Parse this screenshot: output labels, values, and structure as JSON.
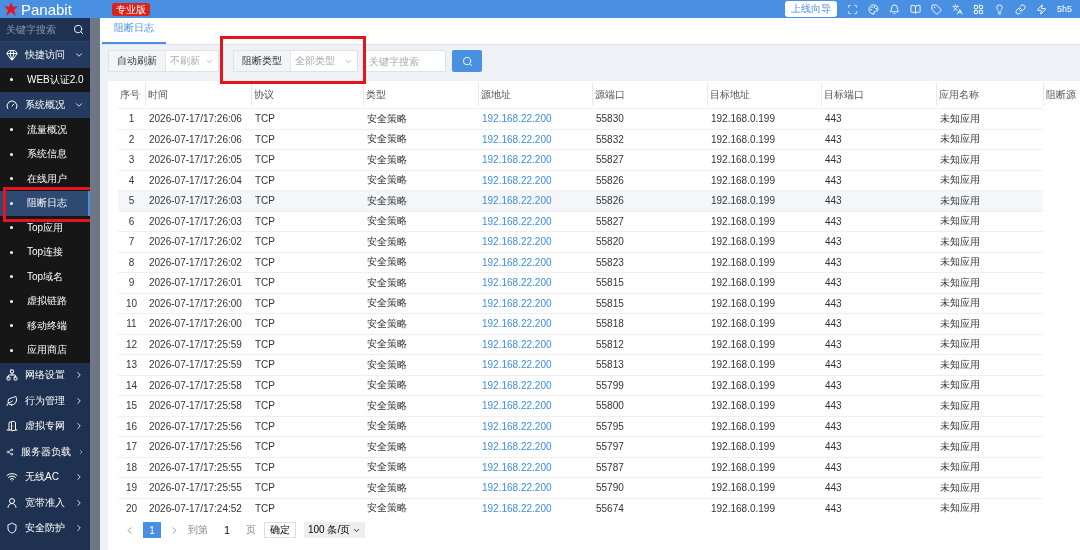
{
  "header": {
    "logo": "Panabit",
    "edition_badge": "专业版",
    "guide_button": "上线向导",
    "corner_text": "5h5"
  },
  "sidebar": {
    "search": {
      "placeholder": "关键字搜索"
    },
    "groups": [
      {
        "label": "快捷访问",
        "expanded": true,
        "children": [
          {
            "label": "WEB认证2.0",
            "selected": false,
            "highlighted": false
          }
        ]
      },
      {
        "label": "系统概况",
        "expanded": true,
        "children": [
          {
            "label": "流量概况",
            "selected": false,
            "highlighted": false
          },
          {
            "label": "系统信息",
            "selected": false,
            "highlighted": false
          },
          {
            "label": "在线用户",
            "selected": false,
            "highlighted": false
          },
          {
            "label": "阻断日志",
            "selected": true,
            "highlighted": true
          },
          {
            "label": "Top应用",
            "selected": false,
            "highlighted": false
          },
          {
            "label": "Top连接",
            "selected": false,
            "highlighted": false
          },
          {
            "label": "Top域名",
            "selected": false,
            "highlighted": false
          },
          {
            "label": "虚拟链路",
            "selected": false,
            "highlighted": false
          },
          {
            "label": "移动终端",
            "selected": false,
            "highlighted": false
          },
          {
            "label": "应用商店",
            "selected": false,
            "highlighted": false
          }
        ]
      },
      {
        "label": "网络设置",
        "expanded": false
      },
      {
        "label": "行为管理",
        "expanded": false
      },
      {
        "label": "虚拟专网",
        "expanded": false
      },
      {
        "label": "服务器负载",
        "expanded": false
      },
      {
        "label": "无线AC",
        "expanded": false
      },
      {
        "label": "宽带准入",
        "expanded": false
      },
      {
        "label": "安全防护",
        "expanded": false
      }
    ]
  },
  "tabs": [
    {
      "label": "阻断日志",
      "selected": true
    }
  ],
  "filters": [
    {
      "label": "自动刷新",
      "value": "不刷新"
    },
    {
      "label": "阻断类型",
      "value": "全部类型",
      "highlighted": true
    }
  ],
  "search": {
    "placeholder": "关键字搜索"
  },
  "table": {
    "columns": [
      "序号",
      "时间",
      "协议",
      "类型",
      "源地址",
      "源端口",
      "目标地址",
      "目标端口",
      "应用名称",
      "阻断源"
    ],
    "rows": [
      [
        "1",
        "2026-07-17/17:26:06",
        "TCP",
        "安全策略",
        "192.168.22.200",
        "55830",
        "192.168.0.199",
        "443",
        "未知应用"
      ],
      [
        "2",
        "2026-07-17/17:26:06",
        "TCP",
        "安全策略",
        "192.168.22.200",
        "55832",
        "192.168.0.199",
        "443",
        "未知应用"
      ],
      [
        "3",
        "2026-07-17/17:26:05",
        "TCP",
        "安全策略",
        "192.168.22.200",
        "55827",
        "192.168.0.199",
        "443",
        "未知应用"
      ],
      [
        "4",
        "2026-07-17/17:26:04",
        "TCP",
        "安全策略",
        "192.168.22.200",
        "55826",
        "192.168.0.199",
        "443",
        "未知应用"
      ],
      [
        "5",
        "2026-07-17/17:26:03",
        "TCP",
        "安全策略",
        "192.168.22.200",
        "55826",
        "192.168.0.199",
        "443",
        "未知应用"
      ],
      [
        "6",
        "2026-07-17/17:26:03",
        "TCP",
        "安全策略",
        "192.168.22.200",
        "55827",
        "192.168.0.199",
        "443",
        "未知应用"
      ],
      [
        "7",
        "2026-07-17/17:26:02",
        "TCP",
        "安全策略",
        "192.168.22.200",
        "55820",
        "192.168.0.199",
        "443",
        "未知应用"
      ],
      [
        "8",
        "2026-07-17/17:26:02",
        "TCP",
        "安全策略",
        "192.168.22.200",
        "55823",
        "192.168.0.199",
        "443",
        "未知应用"
      ],
      [
        "9",
        "2026-07-17/17:26:01",
        "TCP",
        "安全策略",
        "192.168.22.200",
        "55815",
        "192.168.0.199",
        "443",
        "未知应用"
      ],
      [
        "10",
        "2026-07-17/17:26:00",
        "TCP",
        "安全策略",
        "192.168.22.200",
        "55815",
        "192.168.0.199",
        "443",
        "未知应用"
      ],
      [
        "11",
        "2026-07-17/17:26:00",
        "TCP",
        "安全策略",
        "192.168.22.200",
        "55818",
        "192.168.0.199",
        "443",
        "未知应用"
      ],
      [
        "12",
        "2026-07-17/17:25:59",
        "TCP",
        "安全策略",
        "192.168.22.200",
        "55812",
        "192.168.0.199",
        "443",
        "未知应用"
      ],
      [
        "13",
        "2026-07-17/17:25:59",
        "TCP",
        "安全策略",
        "192.168.22.200",
        "55813",
        "192.168.0.199",
        "443",
        "未知应用"
      ],
      [
        "14",
        "2026-07-17/17:25:58",
        "TCP",
        "安全策略",
        "192.168.22.200",
        "55799",
        "192.168.0.199",
        "443",
        "未知应用"
      ],
      [
        "15",
        "2026-07-17/17:25:58",
        "TCP",
        "安全策略",
        "192.168.22.200",
        "55800",
        "192.168.0.199",
        "443",
        "未知应用"
      ],
      [
        "16",
        "2026-07-17/17:25:56",
        "TCP",
        "安全策略",
        "192.168.22.200",
        "55795",
        "192.168.0.199",
        "443",
        "未知应用"
      ],
      [
        "17",
        "2026-07-17/17:25:56",
        "TCP",
        "安全策略",
        "192.168.22.200",
        "55797",
        "192.168.0.199",
        "443",
        "未知应用"
      ],
      [
        "18",
        "2026-07-17/17:25:55",
        "TCP",
        "安全策略",
        "192.168.22.200",
        "55787",
        "192.168.0.199",
        "443",
        "未知应用"
      ],
      [
        "19",
        "2026-07-17/17:25:55",
        "TCP",
        "安全策略",
        "192.168.22.200",
        "55790",
        "192.168.0.199",
        "443",
        "未知应用"
      ],
      [
        "20",
        "2026-07-17/17:24:52",
        "TCP",
        "安全策略",
        "192.168.22.200",
        "55674",
        "192.168.0.199",
        "443",
        "未知应用"
      ]
    ]
  },
  "pagination": {
    "pages": [
      {
        "label": "1",
        "selected": true
      }
    ],
    "goto_label": "到第",
    "goto_value": "1",
    "page_unit": "页",
    "confirm": "确定",
    "page_size": "100 条/页"
  }
}
